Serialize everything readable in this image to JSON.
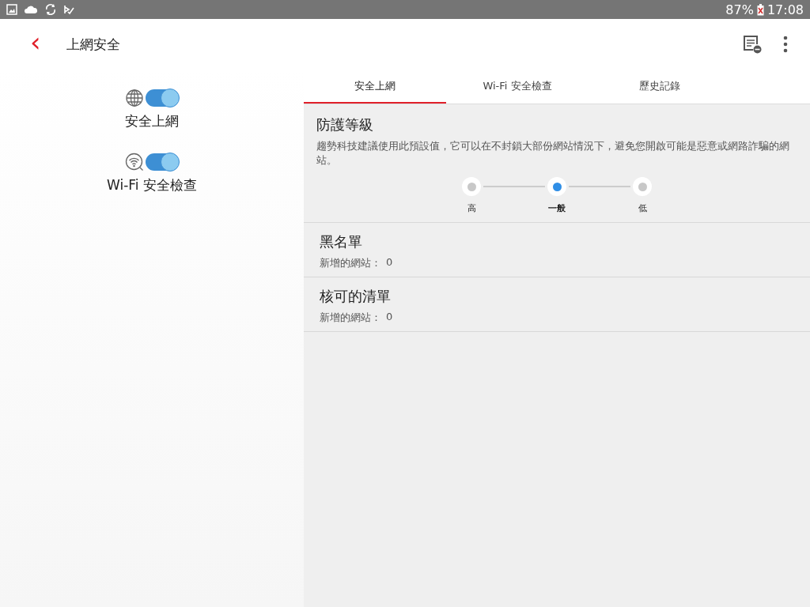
{
  "status_bar": {
    "battery": "87%",
    "time": "17:08"
  },
  "app_bar": {
    "back": "‹",
    "title": "上網安全"
  },
  "features": [
    {
      "kind": "globe",
      "label": "安全上網",
      "on": true
    },
    {
      "kind": "wifi",
      "label": "Wi-Fi 安全檢查",
      "on": true
    }
  ],
  "tabs": [
    {
      "label": "安全上網",
      "selected": true
    },
    {
      "label": "Wi-Fi 安全檢查",
      "selected": false
    },
    {
      "label": "歷史記錄",
      "selected": false
    }
  ],
  "protection": {
    "title": "防護等級",
    "description": "趨勢科技建議使用此預設值，它可以在不封鎖大部份網站情況下，避免您開啟可能是惡意或網路詐騙的網站。",
    "levels": [
      {
        "label": "高",
        "selected": false
      },
      {
        "label": "一般",
        "selected": true
      },
      {
        "label": "低",
        "selected": false
      }
    ]
  },
  "lists": [
    {
      "title": "黑名單",
      "count_label": "新增的網站：",
      "count": "0"
    },
    {
      "title": "核可的清單",
      "count_label": "新增的網站：",
      "count": "0"
    }
  ]
}
